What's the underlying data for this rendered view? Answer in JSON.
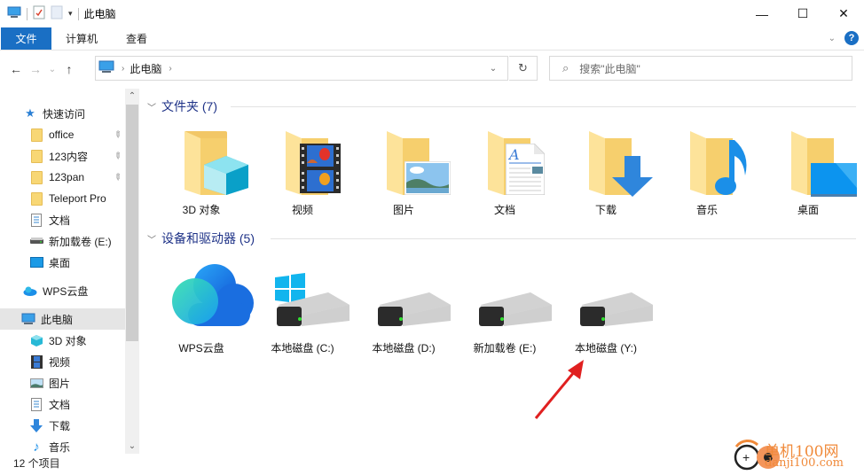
{
  "window": {
    "title": "此电脑",
    "controls": {
      "minimize": "—",
      "maximize": "☐",
      "close": "✕"
    }
  },
  "ribbon": {
    "tabs": [
      {
        "label": "文件",
        "active": true
      },
      {
        "label": "计算机"
      },
      {
        "label": "查看"
      }
    ],
    "help": "?"
  },
  "nav": {
    "back": "←",
    "forward": "→",
    "recent": "⌄",
    "up": "↑",
    "address": {
      "segments": [
        "此电脑"
      ],
      "sep": "›"
    },
    "dropdown": "⌄",
    "refresh": "↻",
    "search_placeholder": "搜索\"此电脑\""
  },
  "sidebar": {
    "items": [
      {
        "label": "快速访问",
        "icon": "star-icon"
      },
      {
        "label": "office",
        "icon": "folder-icon",
        "pinned": true
      },
      {
        "label": "123内容",
        "icon": "folder-icon",
        "pinned": true
      },
      {
        "label": "123pan",
        "icon": "folder-icon",
        "pinned": true
      },
      {
        "label": "Teleport Pro",
        "icon": "folder-icon"
      },
      {
        "label": "文档",
        "icon": "document-icon"
      },
      {
        "label": "新加载卷 (E:)",
        "icon": "drive-icon"
      },
      {
        "label": "桌面",
        "icon": "desktop-icon"
      },
      {
        "label": "WPS云盘",
        "icon": "cloud-icon"
      },
      {
        "label": "此电脑",
        "icon": "computer-icon",
        "selected": true
      },
      {
        "label": "3D 对象",
        "icon": "cube-icon"
      },
      {
        "label": "视频",
        "icon": "video-icon"
      },
      {
        "label": "图片",
        "icon": "picture-icon"
      },
      {
        "label": "文档",
        "icon": "document-icon"
      },
      {
        "label": "下载",
        "icon": "download-icon"
      },
      {
        "label": "音乐",
        "icon": "music-icon"
      }
    ],
    "pin_glyph": "📌"
  },
  "status": {
    "item_count": "12 个项目"
  },
  "main": {
    "folders_header": "文件夹 (7)",
    "folders": [
      {
        "label": "3D 对象",
        "overlay": "cube"
      },
      {
        "label": "视频",
        "overlay": "film"
      },
      {
        "label": "图片",
        "overlay": "picture"
      },
      {
        "label": "文档",
        "overlay": "document"
      },
      {
        "label": "下载",
        "overlay": "download"
      },
      {
        "label": "音乐",
        "overlay": "music"
      },
      {
        "label": "桌面",
        "overlay": "desktop"
      }
    ],
    "drives_header": "设备和驱动器 (5)",
    "drives": [
      {
        "label": "WPS云盘",
        "kind": "cloud"
      },
      {
        "label": "本地磁盘 (C:)",
        "kind": "system"
      },
      {
        "label": "本地磁盘 (D:)",
        "kind": "disk"
      },
      {
        "label": "新加载卷 (E:)",
        "kind": "disk"
      },
      {
        "label": "本地磁盘 (Y:)",
        "kind": "disk"
      }
    ]
  },
  "watermark": {
    "line1": "单机100网",
    "line2": "danji100.com"
  },
  "colors": {
    "accent": "#1a6fc4",
    "header_text": "#1e3287",
    "folder": "#f8d775",
    "arrow": "#e02020"
  }
}
